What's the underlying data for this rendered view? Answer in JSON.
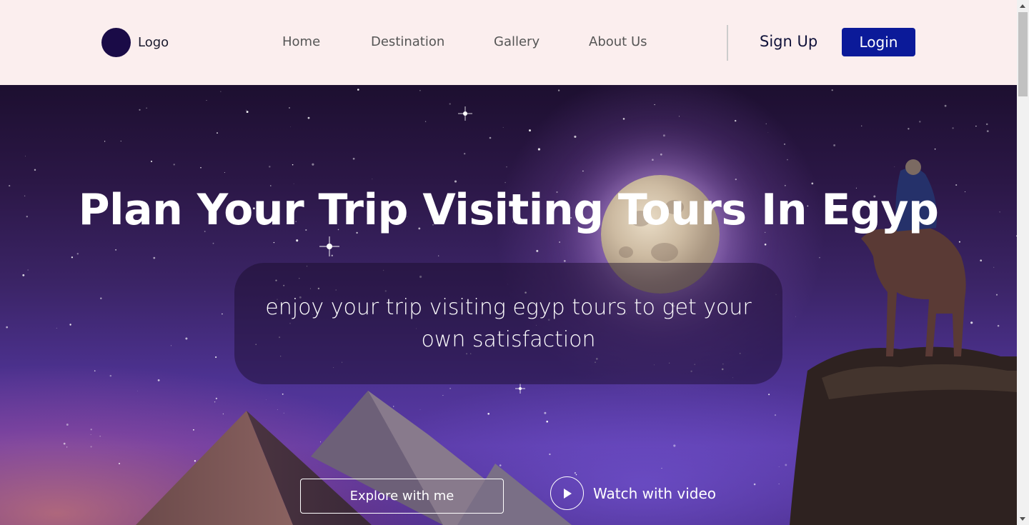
{
  "header": {
    "logo_label": "Logo",
    "nav": [
      "Home",
      "Destination",
      "Gallery",
      "About Us"
    ],
    "signup_label": "Sign Up",
    "login_label": "Login"
  },
  "hero": {
    "title": "Plan Your Trip Visiting Tours In Egyp",
    "subtitle": "enjoy your trip visiting egyp tours to get your own satisfaction",
    "explore_label": "Explore with me",
    "watch_label": "Watch with video"
  },
  "colors": {
    "header_bg": "#fbeeee",
    "logo_circle": "#1a0b47",
    "login_bg": "#0b1a99"
  },
  "icons": {
    "play": "play-icon"
  }
}
